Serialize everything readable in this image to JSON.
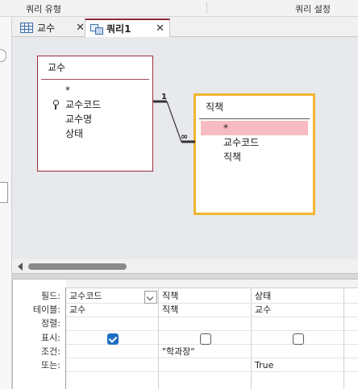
{
  "ribbon": {
    "group_query_type": "쿼리 유형",
    "group_query_setup": "쿼리 설정"
  },
  "tabs": [
    {
      "label": "교수",
      "icon": "table-icon",
      "active": false
    },
    {
      "label": "쿼리1",
      "icon": "query-icon",
      "active": true
    }
  ],
  "close_glyph": "✕",
  "tables": {
    "gyosu": {
      "title": "교수",
      "fields": [
        "*",
        "교수코드",
        "교수명",
        "상태"
      ],
      "primary_key": "교수코드"
    },
    "jikchaek": {
      "title": "직책",
      "fields": [
        "*",
        "교수코드",
        "직책"
      ],
      "selected_field": "*"
    }
  },
  "relationship": {
    "one_side": "1",
    "many_side": "∞"
  },
  "grid": {
    "row_labels": [
      "필드:",
      "테이블:",
      "정렬:",
      "표시:",
      "조건:",
      "또는:"
    ],
    "columns": [
      {
        "field": "교수코드",
        "table": "교수",
        "sort": "",
        "show": true,
        "criteria": "",
        "or": ""
      },
      {
        "field": "직책",
        "table": "직책",
        "sort": "",
        "show": false,
        "criteria": "\"학과장\"",
        "or": ""
      },
      {
        "field": "상태",
        "table": "교수",
        "sort": "",
        "show": false,
        "criteria": "",
        "or": "True"
      }
    ]
  },
  "colors": {
    "accent": "#8c2e3a",
    "selected_table_border": "#f2b630",
    "selected_field": "#f6bcc1",
    "checkbox_on": "#1e6fc3"
  }
}
